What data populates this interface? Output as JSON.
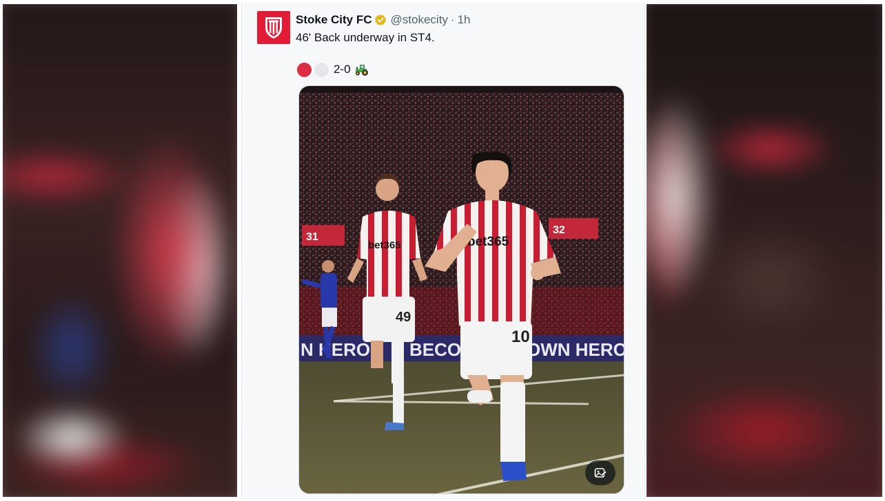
{
  "post": {
    "display_name": "Stoke City FC",
    "handle": "@stokecity",
    "separator": "·",
    "time": "1h",
    "text": "46' Back underway in ST4.",
    "score": "2-0"
  },
  "media": {
    "description_text": "",
    "shirt_sponsor": "bet365",
    "shirt_numbers": [
      "49",
      "10"
    ],
    "board_text": [
      "N HERO",
      "BECOM",
      "OWN HERO"
    ],
    "stand_numbers": [
      "31",
      "32"
    ]
  },
  "colors": {
    "club_red": "#e21b36",
    "verified_gold": "#e2b719",
    "pitch": "#5e5a38",
    "crowd": "#2a1b1e"
  },
  "icons": {
    "avatar": "stoke-crest-icon",
    "verified": "verified-badge-icon",
    "team_dot_1": "red-circle-icon",
    "team_dot_2": "white-circle-icon",
    "emoji": "tractor-icon",
    "media_action": "image-edit-icon"
  }
}
